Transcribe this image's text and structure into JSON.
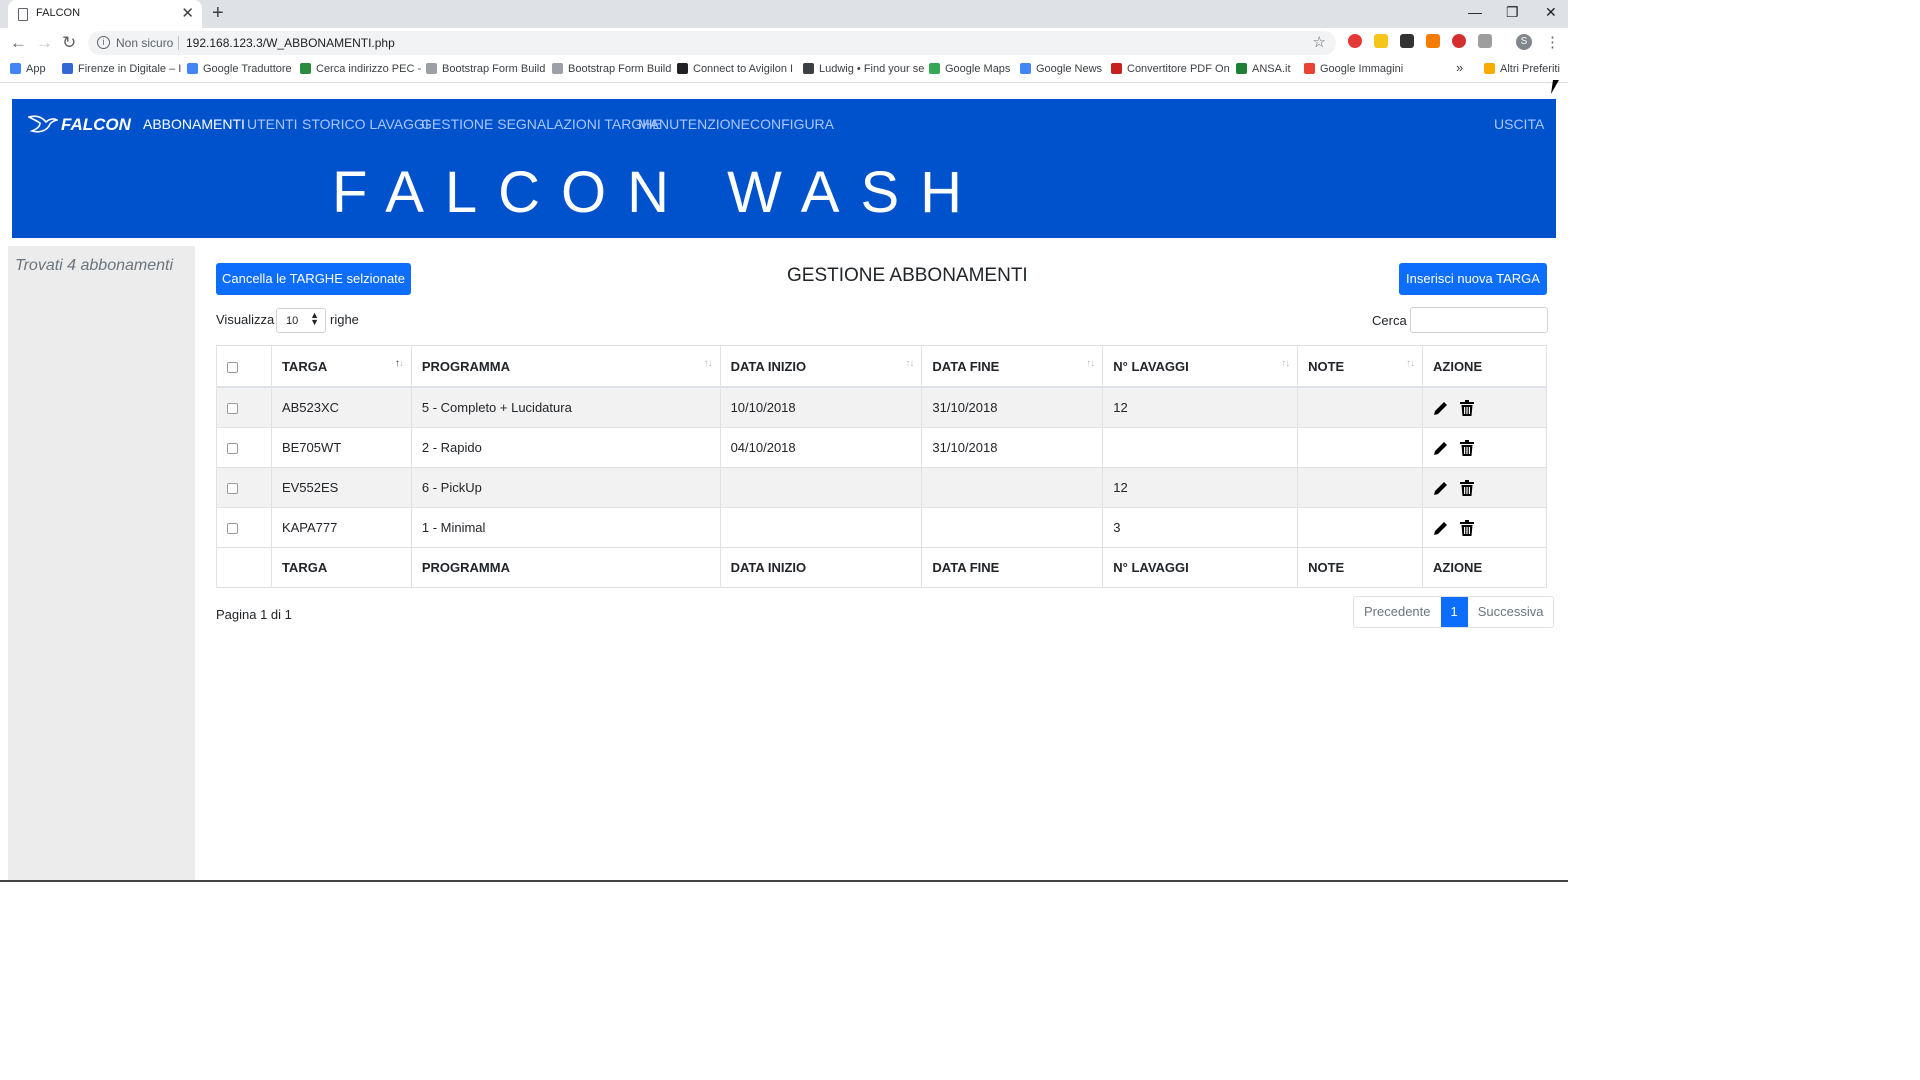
{
  "browser": {
    "tab_title": "FALCON",
    "not_secure": "Non sicuro",
    "url": "192.168.123.3/W_ABBONAMENTI.php",
    "bookmarks": [
      {
        "label": "App",
        "color": "#4285f4"
      },
      {
        "label": "Firenze in Digitale – I",
        "color": "#3367d6"
      },
      {
        "label": "Google Traduttore",
        "color": "#4285f4"
      },
      {
        "label": "Cerca indirizzo PEC -",
        "color": "#2a8c3c"
      },
      {
        "label": "Bootstrap Form Build",
        "color": "#9aa0a6"
      },
      {
        "label": "Bootstrap Form Build",
        "color": "#9aa0a6"
      },
      {
        "label": "Connect to Avigilon I",
        "color": "#202124"
      },
      {
        "label": "Ludwig • Find your se",
        "color": "#3c4043"
      },
      {
        "label": "Google Maps",
        "color": "#34a853"
      },
      {
        "label": "Google News",
        "color": "#4285f4"
      },
      {
        "label": "Convertitore PDF On",
        "color": "#c5221f"
      },
      {
        "label": "ANSA.it",
        "color": "#1e7e34"
      },
      {
        "label": "Google Immagini",
        "color": "#ea4335"
      }
    ],
    "other_bookmarks": "Altri Preferiti",
    "profile_initial": "S"
  },
  "nav": {
    "logo": "FALCON",
    "items": [
      "ABBONAMENTI",
      "UTENTI",
      "STORICO LAVAGGI",
      "GESTIONE SEGNALAZIONI TARGHE",
      "MANUTENZIONE",
      "CONFIGURA"
    ],
    "active": "ABBONAMENTI",
    "logout": "USCITA",
    "banner": "FALCON WASH"
  },
  "sidebar": {
    "found_text": "Trovati 4 abbonamenti"
  },
  "main": {
    "delete_selected_label": "Cancella le TARGHE selzionate",
    "title": "GESTIONE ABBONAMENTI",
    "insert_label": "Inserisci nuova TARGA",
    "show_label": "Visualizza",
    "rows_per_page": "10",
    "rows_label": "righe",
    "search_label": "Cerca",
    "search_value": ""
  },
  "table": {
    "columns": [
      "TARGA",
      "PROGRAMMA",
      "DATA INIZIO",
      "DATA FINE",
      "N° LAVAGGI",
      "NOTE",
      "AZIONE"
    ],
    "rows": [
      {
        "targa": "AB523XC",
        "programma": "5 - Completo + Lucidatura",
        "data_inizio": "10/10/2018",
        "data_fine": "31/10/2018",
        "lavaggi": "12",
        "note": ""
      },
      {
        "targa": "BE705WT",
        "programma": "2 - Rapido",
        "data_inizio": "04/10/2018",
        "data_fine": "31/10/2018",
        "lavaggi": "",
        "note": ""
      },
      {
        "targa": "EV552ES",
        "programma": "6 - PickUp",
        "data_inizio": "",
        "data_fine": "",
        "lavaggi": "12",
        "note": ""
      },
      {
        "targa": "KAPA777",
        "programma": "1 - Minimal",
        "data_inizio": "",
        "data_fine": "",
        "lavaggi": "3",
        "note": ""
      }
    ]
  },
  "pagination": {
    "info": "Pagina 1 di 1",
    "prev": "Precedente",
    "current": "1",
    "next": "Successiva"
  },
  "colors": {
    "brand": "#0052cc",
    "primary": "#0d6efd"
  }
}
